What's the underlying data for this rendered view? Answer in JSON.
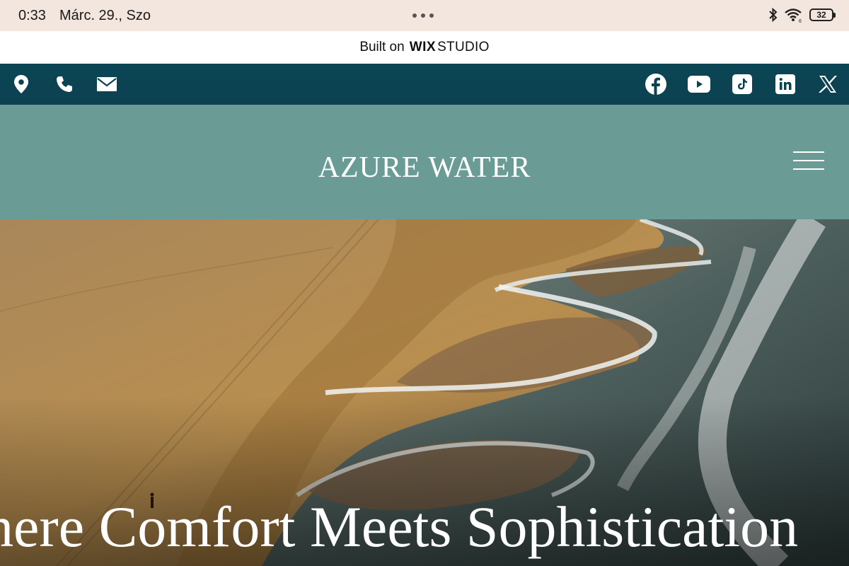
{
  "status_bar": {
    "time": "0:33",
    "date": "Márc. 29., Szo",
    "battery": "32"
  },
  "wix_banner": {
    "built_on": "Built on",
    "brand_wix": "WIX",
    "brand_studio": "STUDIO"
  },
  "top_bar": {
    "left_icons": [
      "location-pin-icon",
      "phone-icon",
      "mail-icon"
    ],
    "right_icons": [
      "facebook-icon",
      "youtube-icon",
      "tiktok-icon",
      "linkedin-icon",
      "x-icon"
    ]
  },
  "header": {
    "brand": "AZURE WATER"
  },
  "hero": {
    "headline": "here Comfort Meets Sophistication"
  },
  "colors": {
    "status_bg": "#f3e6df",
    "top_bar_bg": "#0c4150",
    "header_bg": "#6a9c95",
    "sand": "#b38a52",
    "sea": "#3e5452"
  }
}
